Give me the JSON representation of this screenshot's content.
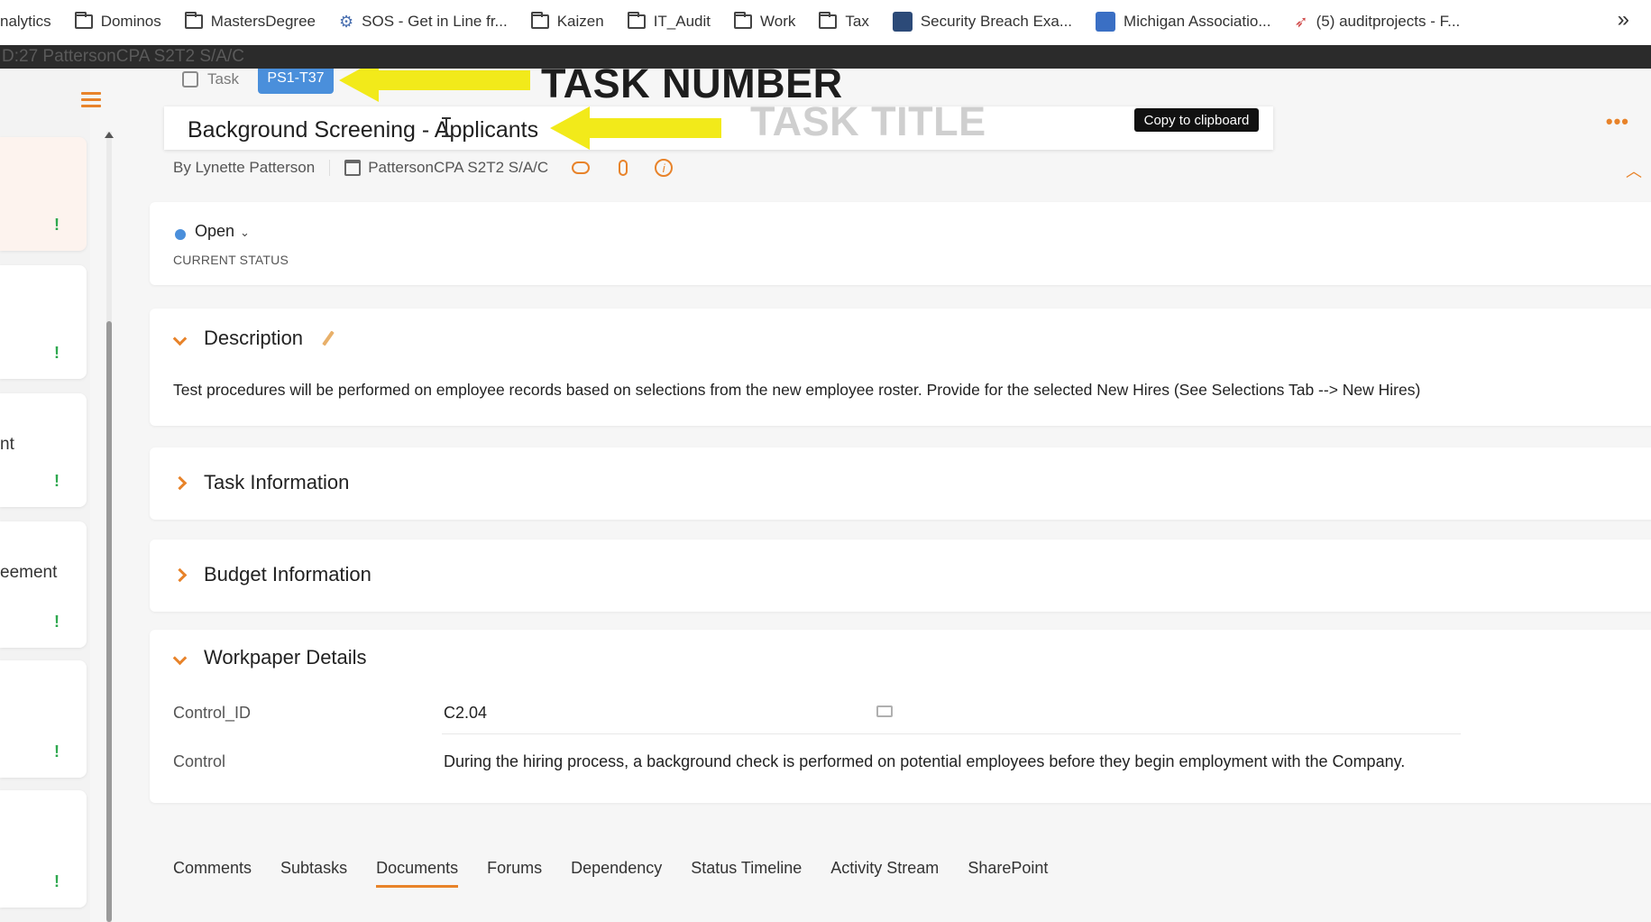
{
  "bookmarks": [
    {
      "label": "nalytics",
      "icon": "none"
    },
    {
      "label": "Dominos",
      "icon": "folder-icon"
    },
    {
      "label": "MastersDegree",
      "icon": "folder-icon"
    },
    {
      "label": "SOS - Get in Line fr...",
      "icon": "sos-icon"
    },
    {
      "label": "Kaizen",
      "icon": "folder-icon"
    },
    {
      "label": "IT_Audit",
      "icon": "folder-icon"
    },
    {
      "label": "Work",
      "icon": "folder-icon"
    },
    {
      "label": "Tax",
      "icon": "folder-icon"
    },
    {
      "label": "Security Breach Exa...",
      "icon": "site-favicon-icon"
    },
    {
      "label": "Michigan Associatio...",
      "icon": "cpa-favicon-icon"
    },
    {
      "label": "(5) auditprojects - F...",
      "icon": "rocket-favicon-icon"
    }
  ],
  "bookmarks_more": "»",
  "window_strip": "D:27  PattersonCPA S2T2 S/A/C",
  "left_list": {
    "fragments": [
      "",
      "",
      "nt",
      "eement",
      "",
      ""
    ],
    "flag": "!"
  },
  "task": {
    "type_label": "Task",
    "number": "PS1-T37",
    "title": "Background Screening - Applicants",
    "copy_label": "Copy to clipboard",
    "more": "•••",
    "author": "By Lynette Patterson",
    "project": "PattersonCPA S2T2 S/A/C",
    "info_glyph": "i"
  },
  "status": {
    "value": "Open",
    "label": "CURRENT STATUS",
    "color": "#4a8fdb"
  },
  "description": {
    "heading": "Description",
    "text": "Test procedures will be performed on employee records based on selections from the new employee roster. Provide for the selected New Hires (See Selections Tab --> New Hires)"
  },
  "sections": {
    "task_info": "Task Information",
    "budget_info": "Budget Information",
    "workpaper": "Workpaper Details"
  },
  "workpaper_rows": [
    {
      "key": "Control_ID",
      "value": "C2.04"
    },
    {
      "key": "Control",
      "value": "During the hiring process, a background check is performed on potential employees before they begin employment with the Company."
    }
  ],
  "tabs": [
    "Comments",
    "Subtasks",
    "Documents",
    "Forums",
    "Dependency",
    "Status Timeline",
    "Activity Stream",
    "SharePoint"
  ],
  "active_tab": "Documents",
  "annotations": {
    "task_number": "TASK NUMBER",
    "task_title": "TASK TITLE"
  },
  "colors": {
    "accent": "#e8832a",
    "badge": "#4a8fdb",
    "highlight_arrow": "#f2ea1a"
  }
}
